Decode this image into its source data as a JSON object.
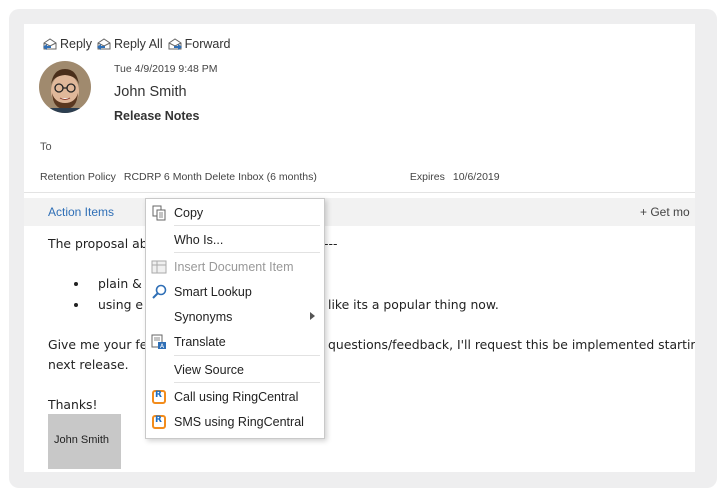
{
  "toolbar": {
    "reply": "Reply",
    "reply_all": "Reply All",
    "forward": "Forward"
  },
  "message": {
    "date": "Tue 4/9/2019 9:48 PM",
    "sender": "John Smith",
    "subject": "Release Notes",
    "to_label": "To"
  },
  "retention": {
    "label": "Retention Policy",
    "policy": "RCDRP 6 Month Delete Inbox (6 months)",
    "expires_label": "Expires",
    "expires_date": "10/6/2019"
  },
  "actionbar": {
    "action_items": "Action Items",
    "get_more": "+ Get mo"
  },
  "body": {
    "line1": "The proposal ab",
    "line1_tail": "---",
    "bullet1": "plain &",
    "bullet2": "using e",
    "bullet2_tail": "like its a popular thing now.",
    "line2": "Give me your fe",
    "line2_tail": "questions/feedback, I'll request this be implemented startir",
    "line3": "next release.",
    "thanks": "Thanks!",
    "signature": "John Smith"
  },
  "context_menu": {
    "items": [
      {
        "label": "Copy",
        "icon": "copy-icon"
      },
      {
        "label": "Who Is...",
        "icon": ""
      },
      {
        "label": "Insert Document Item",
        "icon": "insert-document-icon"
      },
      {
        "label": "Smart Lookup",
        "icon": "smart-lookup-icon"
      },
      {
        "label": "Synonyms",
        "icon": ""
      },
      {
        "label": "Translate",
        "icon": "translate-icon"
      },
      {
        "label": "View Source",
        "icon": ""
      },
      {
        "label": "Call using RingCentral",
        "icon": "ringcentral-icon"
      },
      {
        "label": "SMS using RingCentral",
        "icon": "ringcentral-icon"
      }
    ]
  },
  "colors": {
    "accent": "#2f6fb6",
    "ringcentral_orange": "#f28c1c",
    "ringcentral_blue": "#1c6ec4"
  }
}
